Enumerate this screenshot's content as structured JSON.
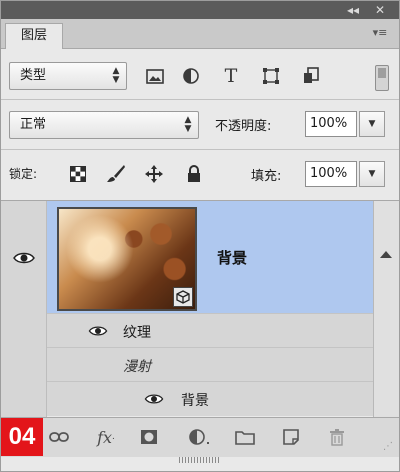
{
  "window": {
    "collapse_label": "◂◂",
    "close_label": "✕"
  },
  "tab": {
    "label": "图层",
    "menu_icon": "panel-menu-icon"
  },
  "filter": {
    "type_select": "类型",
    "icons": [
      "image-filter-icon",
      "adjustment-filter-icon",
      "type-filter-icon",
      "shape-filter-icon",
      "smart-object-filter-icon"
    ],
    "type_icon_glyph": "T"
  },
  "blend": {
    "mode": "正常",
    "opacity_label": "不透明度:",
    "opacity_value": "100%"
  },
  "lock": {
    "label": "锁定:",
    "fill_label": "填充:",
    "fill_value": "100%"
  },
  "layers": {
    "main": {
      "name": "背景",
      "visible": true
    },
    "effects_label": "纹理",
    "mapping_label": "漫射",
    "sub_layer": "背景"
  },
  "toolbar": {
    "fx_label": "fx",
    "step_badge": "04"
  },
  "colors": {
    "selection": "#afc8ef",
    "badge": "#e3151a",
    "panel": "#e9e9e9"
  }
}
